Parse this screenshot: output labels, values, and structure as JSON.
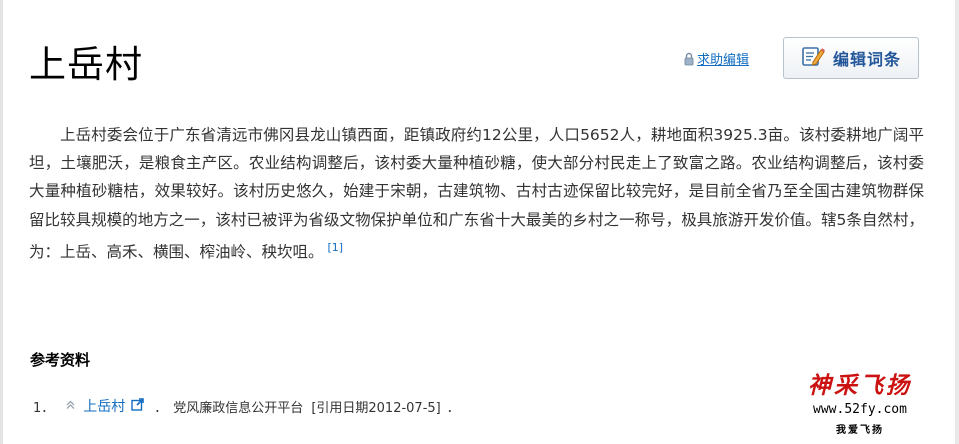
{
  "header": {
    "title": "上岳村",
    "help_edit_label": "求助编辑",
    "edit_button_label": "编辑词条"
  },
  "content": {
    "paragraph": "上岳村委会位于广东省清远市佛冈县龙山镇西面，距镇政府约12公里，人口5652人，耕地面积3925.3亩。该村委耕地广阔平坦，土壤肥沃，是粮食主产区。农业结构调整后，该村委大量种植砂糖，使大部分村民走上了致富之路。农业结构调整后，该村委大量种植砂糖桔，效果较好。该村历史悠久，始建于宋朝，古建筑物、古村古迹保留比较完好，是目前全省乃至全国古建筑物群保留比较具规模的地方之一，该村已被评为省级文物保护单位和广东省十大最美的乡村之一称号，极具旅游开发价值。辖5条自然村，为：上岳、高禾、横围、榨油岭、秧坎咀。",
    "citation_marker": "[1]"
  },
  "references": {
    "title": "参考资料",
    "items": [
      {
        "number": "1．",
        "link_text": "上岳村",
        "separator": "．",
        "source": "党风廉政信息公开平台",
        "cite_date": "[引用日期2012-07-5]",
        "end": "．"
      }
    ]
  },
  "watermark": {
    "brand": "神采飞扬",
    "url": "www.52fy.com",
    "subtitle": "我爱飞扬",
    "brand_color": "#cc1111"
  },
  "icons": {
    "help": "lock-icon",
    "edit": "edit-pencil-icon",
    "vote": "chevron-up-icon",
    "external": "external-link-icon"
  },
  "colors": {
    "link": "#136ec2",
    "edit_label": "#23579a",
    "text": "#333333"
  }
}
